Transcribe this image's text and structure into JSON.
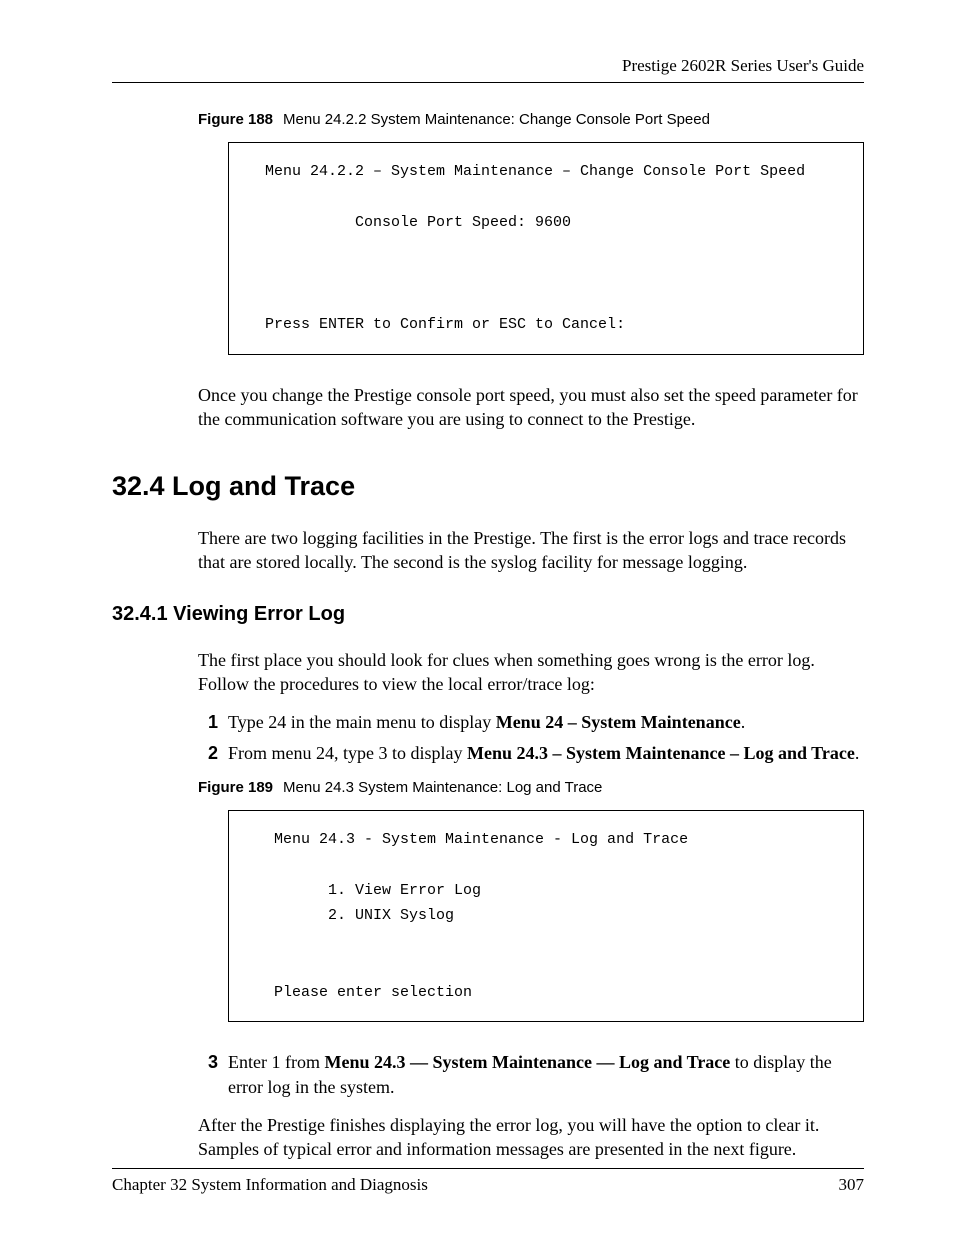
{
  "header": {
    "doc_title": "Prestige 2602R Series User's Guide"
  },
  "figure188": {
    "label": "Figure 188",
    "caption": "Menu 24.2.2 System Maintenance: Change Console Port Speed",
    "console": "    Menu 24.2.2 – System Maintenance – Change Console Port Speed\n\n              Console Port Speed: 9600\n\n\n\n    Press ENTER to Confirm or ESC to Cancel:"
  },
  "para1": "Once you change the Prestige console port speed, you must also set the speed parameter for the communication software you are using to connect to the Prestige.",
  "section_heading": "32.4  Log and Trace",
  "para2": "There are two logging facilities in the Prestige. The first is the error logs and trace records that are stored locally. The second is the syslog facility for message logging.",
  "subsection_heading": "32.4.1  Viewing Error Log",
  "para3": "The first place you should look for clues when something goes wrong is the error log. Follow the procedures to view the local error/trace log:",
  "steps12": [
    {
      "marker": "1",
      "pre": "Type 24 in the main menu to display ",
      "bold": "Menu 24 – System Maintenance",
      "post": "."
    },
    {
      "marker": "2",
      "pre": "From menu 24, type 3 to display ",
      "bold": "Menu 24.3 – System Maintenance – Log and Trace",
      "post": "."
    }
  ],
  "figure189": {
    "label": "Figure 189",
    "caption": "Menu 24.3 System Maintenance: Log and Trace",
    "console": "     Menu 24.3 - System Maintenance - Log and Trace\n\n           1. View Error Log\n           2. UNIX Syslog\n\n\n     Please enter selection"
  },
  "step3": {
    "marker": "3",
    "pre": "Enter 1 from ",
    "bold": "Menu 24.3 — System Maintenance — Log and Trace",
    "post": " to display the error log in the system."
  },
  "para4": "After the Prestige finishes displaying the error log, you will have the option to clear it. Samples of typical error and information messages are presented in the next figure.",
  "footer": {
    "chapter": "Chapter 32 System Information and Diagnosis",
    "page": "307"
  }
}
